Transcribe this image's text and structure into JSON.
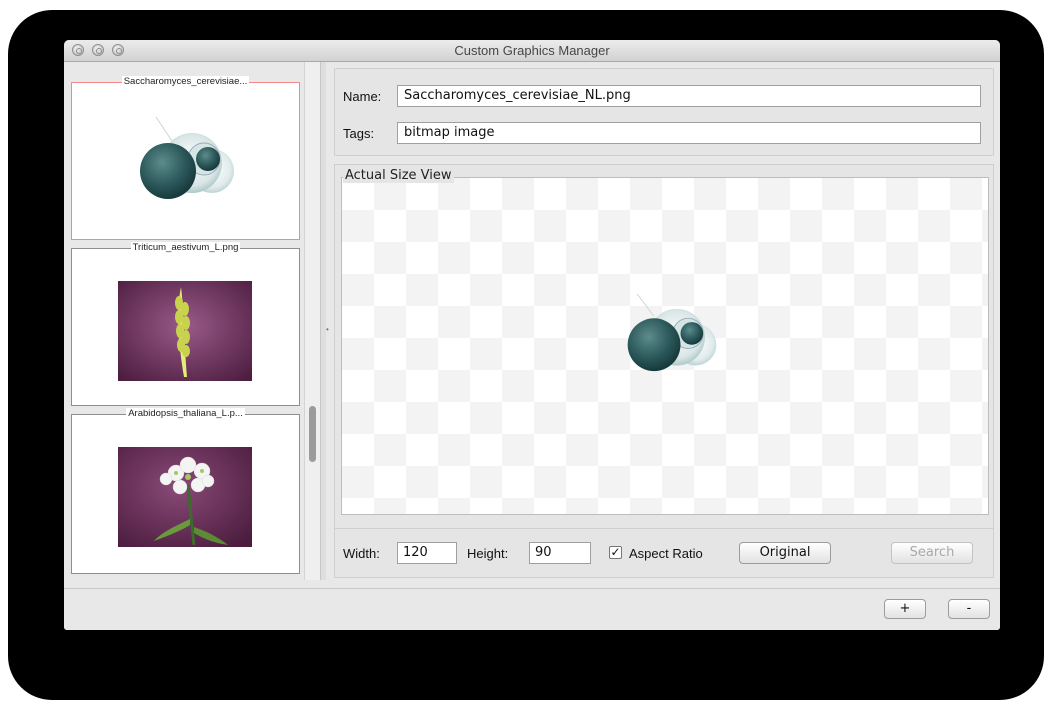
{
  "window": {
    "title": "Custom Graphics Manager"
  },
  "list": {
    "items": [
      {
        "caption": "Saccharomyces_cerevisiae...",
        "image": "yeast-cells-image",
        "selected": true
      },
      {
        "caption": "Triticum_aestivum_L.png",
        "image": "wheat-ear-image",
        "selected": false
      },
      {
        "caption": "Arabidopsis_thaliana_L.p...",
        "image": "arabidopsis-flower-image",
        "selected": false
      }
    ]
  },
  "details": {
    "name_label": "Name:",
    "name_value": "Saccharomyces_cerevisiae_NL.png",
    "tags_label": "Tags:",
    "tags_value": "bitmap image"
  },
  "view": {
    "legend": "Actual Size View"
  },
  "size_controls": {
    "width_label": "Width:",
    "width_value": "120",
    "height_label": "Height:",
    "height_value": "90",
    "aspect_ratio_label": "Aspect Ratio",
    "aspect_ratio_checked": true,
    "original_button": "Original",
    "search_button": "Search"
  },
  "footer": {
    "add_button": "+",
    "remove_button": "-"
  },
  "colors": {
    "selection_border": "#f08a8a",
    "thumbnail_background": "#6a2b56"
  }
}
